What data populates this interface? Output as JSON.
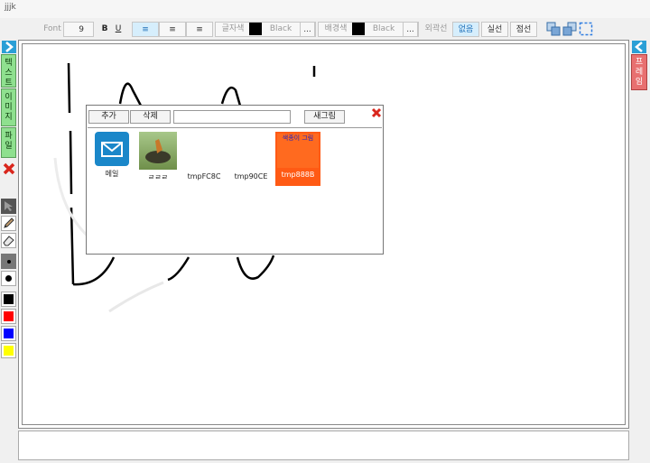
{
  "window": {
    "title": "jjjk"
  },
  "toolbar": {
    "font_label": "Font",
    "font_size": "9",
    "bold": "B",
    "underline": "U",
    "align_left": "≡",
    "align_center": "≡",
    "align_right": "≡",
    "text_color_label": "글자색",
    "text_color_name": "Black",
    "text_color_more": "...",
    "bg_color_label": "배경색",
    "bg_color_name": "Black",
    "bg_color_more": "...",
    "border_label": "외곽선",
    "border_none": "없음",
    "border_solid": "실선",
    "border_dotted": "점선"
  },
  "left_panel": {
    "tabs": [
      "텍스트",
      "이미지",
      "파일"
    ],
    "toggle_icon": "chevron-right-icon",
    "delete_icon": "close-icon",
    "tools": [
      "pointer-icon",
      "pencil-icon",
      "eraser-icon"
    ],
    "pen_sizes": [
      "small-dot",
      "large-dot"
    ],
    "colors": [
      "#000000",
      "#ff0000",
      "#0000ff",
      "#ffff00"
    ]
  },
  "right_panel": {
    "tab": "프레임",
    "toggle_icon": "chevron-left-icon"
  },
  "dialog": {
    "add_label": "추가",
    "delete_label": "삭제",
    "search_value": "",
    "new_label": "새그림",
    "close_icon": "close-icon",
    "items": [
      {
        "label": "메일",
        "kind": "mail"
      },
      {
        "label": "ㄹㄹㄹ",
        "kind": "photo"
      },
      {
        "label": "tmpFC8C",
        "kind": "blank"
      },
      {
        "label": "tmp90CE",
        "kind": "blank"
      },
      {
        "label": "tmp888B",
        "kind": "orange",
        "caption": "색종이 그림"
      }
    ]
  }
}
